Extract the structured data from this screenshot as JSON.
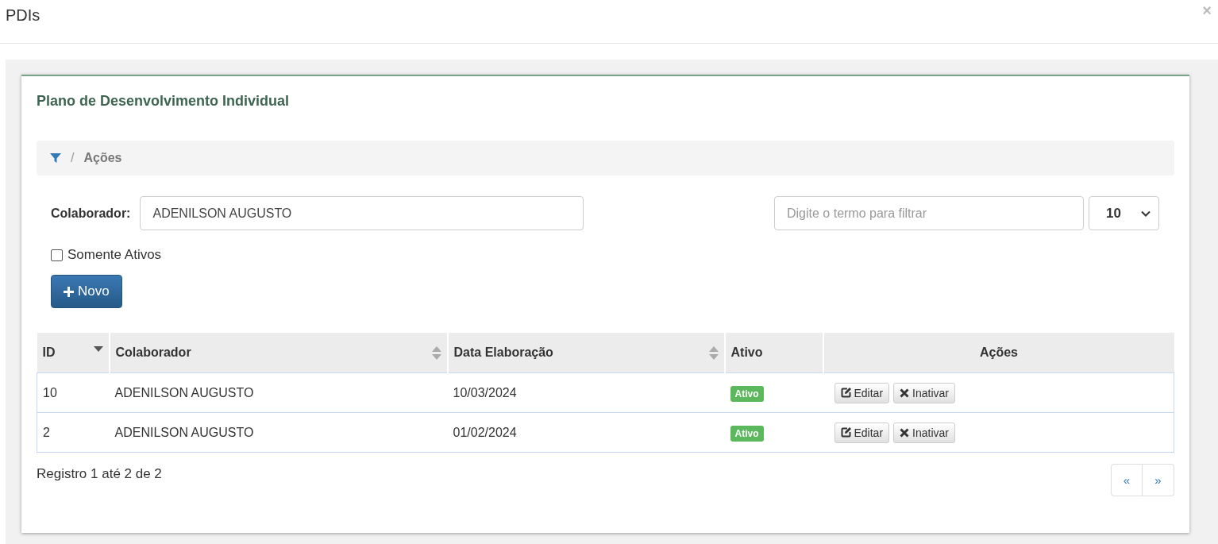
{
  "modal": {
    "title": "PDIs",
    "close": "×"
  },
  "card": {
    "title": "Plano de Desenvolvimento Individual"
  },
  "breadcrumb": {
    "separator": "/",
    "current": "Ações"
  },
  "filter": {
    "label": "Colaborador:",
    "value": "ADENILSON AUGUSTO",
    "search_placeholder": "Digite o termo para filtrar",
    "page_size": "10"
  },
  "only_active": {
    "label": "Somente Ativos",
    "checked": false
  },
  "new_button": {
    "label": "Novo"
  },
  "table": {
    "columns": [
      {
        "label": "ID",
        "sorted_desc": true
      },
      {
        "label": "Colaborador",
        "sortable": true,
        "sorted_desc": false
      },
      {
        "label": "Data Elaboração",
        "sortable": true,
        "sorted_desc": false
      },
      {
        "label": "Ativo",
        "sortable": false
      },
      {
        "label": "Ações",
        "sortable": false
      }
    ],
    "rows": [
      {
        "id": "10",
        "colaborador": "ADENILSON AUGUSTO",
        "data": "10/03/2024",
        "status": "Ativo",
        "active": true,
        "actions": [
          "Editar",
          "Inativar"
        ]
      },
      {
        "id": "2",
        "colaborador": "ADENILSON AUGUSTO",
        "data": "01/02/2024",
        "status": "Ativo",
        "active": true,
        "actions": [
          "Editar",
          "Inativar"
        ]
      }
    ]
  },
  "footer": {
    "info": "Registro 1 até 2 de 2",
    "prev": "«",
    "next": "»"
  }
}
